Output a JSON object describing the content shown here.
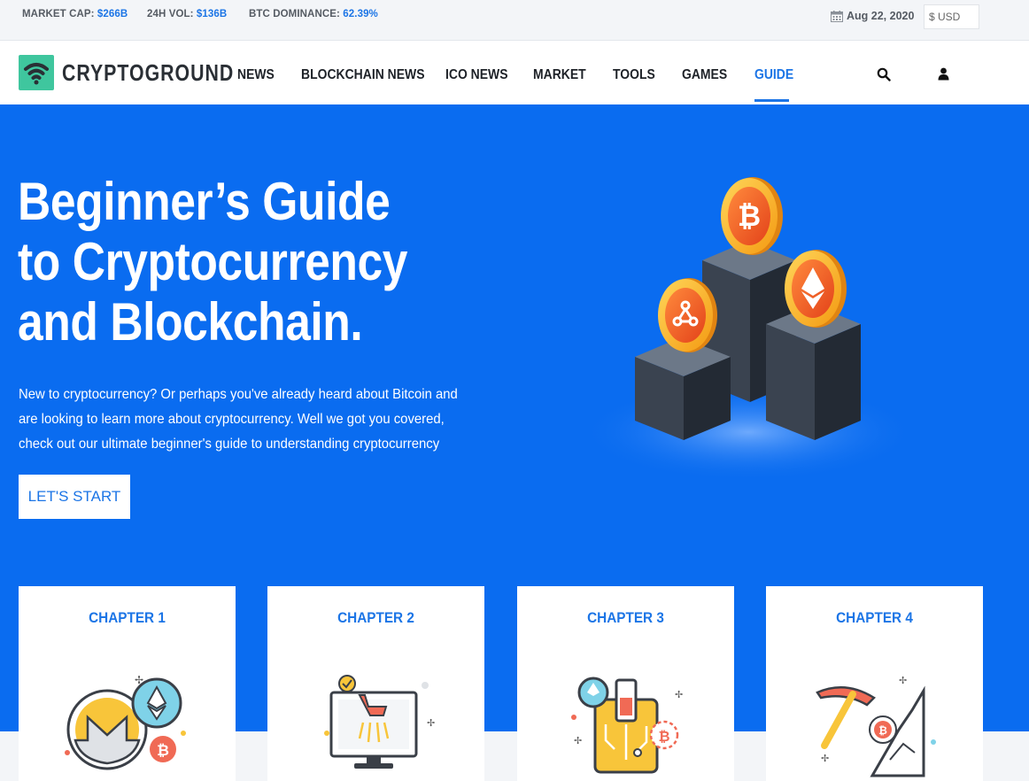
{
  "ticker": {
    "market_cap_label": "MARKET CAP:",
    "market_cap_value": "$266B",
    "vol_label": "24H VOL:",
    "vol_value": "$136B",
    "dominance_label": "BTC DOMINANCE:",
    "dominance_value": "62.39%",
    "date": "Aug 22, 2020",
    "currency": "$ USD"
  },
  "header": {
    "logo_text": "CRYPTOGROUND",
    "nav": [
      "NEWS",
      "BLOCKCHAIN NEWS",
      "ICO NEWS",
      "MARKET",
      "TOOLS",
      "GAMES",
      "GUIDE"
    ],
    "active_nav": "GUIDE",
    "icons": [
      "search-icon",
      "user-icon"
    ]
  },
  "hero": {
    "title": "Beginner’s Guide to Cryptocurrency and Blockchain.",
    "text": "New to cryptocurrency? Or perhaps you've already heard about Bitcoin and are looking to learn more about cryptocurrency. Well we got you covered, check out our ultimate beginner's guide to understanding cryptocurrency",
    "button": "LET'S START"
  },
  "chapters": [
    {
      "title": "CHAPTER 1",
      "icon": "monero-coins-icon"
    },
    {
      "title": "CHAPTER 2",
      "icon": "computer-cart-icon"
    },
    {
      "title": "CHAPTER 3",
      "icon": "wallet-circuit-icon"
    },
    {
      "title": "CHAPTER 4",
      "icon": "mining-pickaxe-icon"
    }
  ],
  "colors": {
    "brand_blue": "#0a6cf0",
    "accent_blue": "#1c75e6",
    "logo_green": "#3fc69e"
  }
}
